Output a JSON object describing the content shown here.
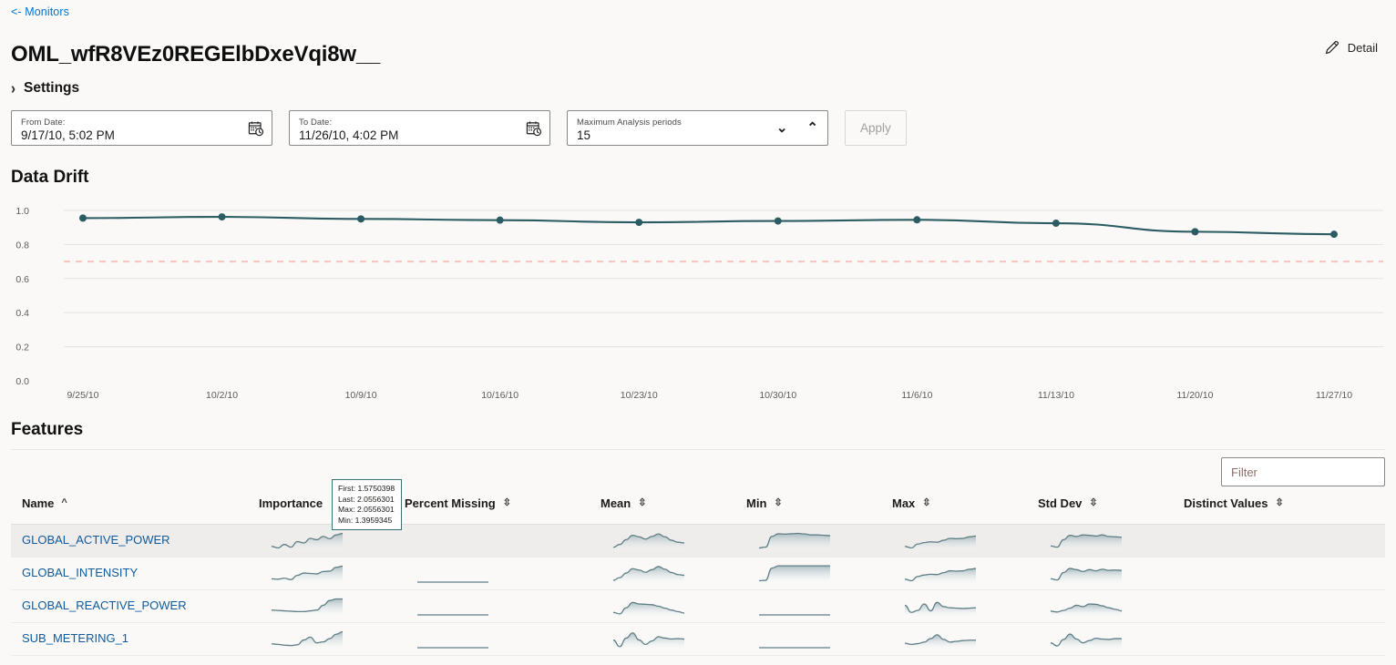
{
  "breadcrumb": {
    "label": "<- Monitors"
  },
  "header": {
    "title": "OML_wfR8VEz0REGElbDxeVqi8w__",
    "detail_label": "Detail",
    "detail_icon": "pencil-icon"
  },
  "settings": {
    "label": "Settings",
    "chevron": "chevron-right-icon",
    "expanded": false
  },
  "controls": {
    "from_date": {
      "label": "From Date:",
      "value": "9/17/10, 5:02 PM",
      "icon": "calendar-clock-icon"
    },
    "to_date": {
      "label": "To Date:",
      "value": "11/26/10, 4:02 PM",
      "icon": "calendar-clock-icon"
    },
    "max_periods": {
      "label": "Maximum Analysis periods",
      "value": "15",
      "down_icon": "chevron-down-icon",
      "up_icon": "chevron-up-icon"
    },
    "apply": {
      "label": "Apply",
      "disabled": true
    }
  },
  "data_drift": {
    "heading": "Data Drift"
  },
  "chart_data": {
    "type": "line",
    "title": "Data Drift",
    "xlabel": "",
    "ylabel": "",
    "ylim": [
      0.0,
      1.0
    ],
    "yticks": [
      0.0,
      0.2,
      0.4,
      0.6,
      0.8,
      1.0
    ],
    "ytick_labels": [
      "0.0",
      "0.2",
      "0.4",
      "0.6",
      "0.8",
      "1.0"
    ],
    "grid": true,
    "legend": "none",
    "x": [
      "9/25/10",
      "10/2/10",
      "10/9/10",
      "10/16/10",
      "10/23/10",
      "10/30/10",
      "11/6/10",
      "11/13/10",
      "11/20/10",
      "11/27/10"
    ],
    "xtick_labels": [
      "9/25/10",
      "10/2/10",
      "10/9/10",
      "10/16/10",
      "10/23/10",
      "10/30/10",
      "11/6/10",
      "11/13/10",
      "11/20/10",
      "11/27/10"
    ],
    "series": [
      {
        "name": "Drift",
        "color": "#2b5c63",
        "marker": "circle",
        "values": [
          0.955,
          0.962,
          0.95,
          0.943,
          0.93,
          0.938,
          0.945,
          0.925,
          0.875,
          0.86
        ]
      }
    ],
    "threshold_line": {
      "value": 0.7,
      "color": "#f7c3c0",
      "style": "dashed"
    }
  },
  "features": {
    "heading": "Features",
    "filter_placeholder": "Filter",
    "filter_value": "",
    "columns": [
      {
        "key": "name",
        "label": "Name",
        "sort": "asc",
        "sort_icon": "caret-up-icon"
      },
      {
        "key": "imp",
        "label": "Importance",
        "sort": "none",
        "sort_icon": ""
      },
      {
        "key": "pm",
        "label": "Percent Missing",
        "sort": "none",
        "sort_icon": "sort-icon"
      },
      {
        "key": "mean",
        "label": "Mean",
        "sort": "none",
        "sort_icon": "sort-icon"
      },
      {
        "key": "min",
        "label": "Min",
        "sort": "none",
        "sort_icon": "sort-icon"
      },
      {
        "key": "max",
        "label": "Max",
        "sort": "none",
        "sort_icon": "sort-icon"
      },
      {
        "key": "sd",
        "label": "Std Dev",
        "sort": "none",
        "sort_icon": "sort-icon"
      },
      {
        "key": "dv",
        "label": "Distinct Values",
        "sort": "none",
        "sort_icon": "sort-icon"
      }
    ],
    "rows": [
      {
        "name": "GLOBAL_ACTIVE_POWER",
        "highlighted": true
      },
      {
        "name": "GLOBAL_INTENSITY",
        "highlighted": false
      },
      {
        "name": "GLOBAL_REACTIVE_POWER",
        "highlighted": false
      },
      {
        "name": "SUB_METERING_1",
        "highlighted": false
      }
    ]
  },
  "tooltip": {
    "first": "First: 1.5750398",
    "last": "Last: 2.0556301",
    "max": "Max: 2.0556301",
    "min": "Min: 1.3959345"
  },
  "colors": {
    "link": "#0572ce",
    "table_link": "#0e5a9c",
    "line": "#2b5c63",
    "threshold": "#f7c3c0",
    "page_bg": "#faf9f8",
    "row_alt": "#efedeb"
  }
}
